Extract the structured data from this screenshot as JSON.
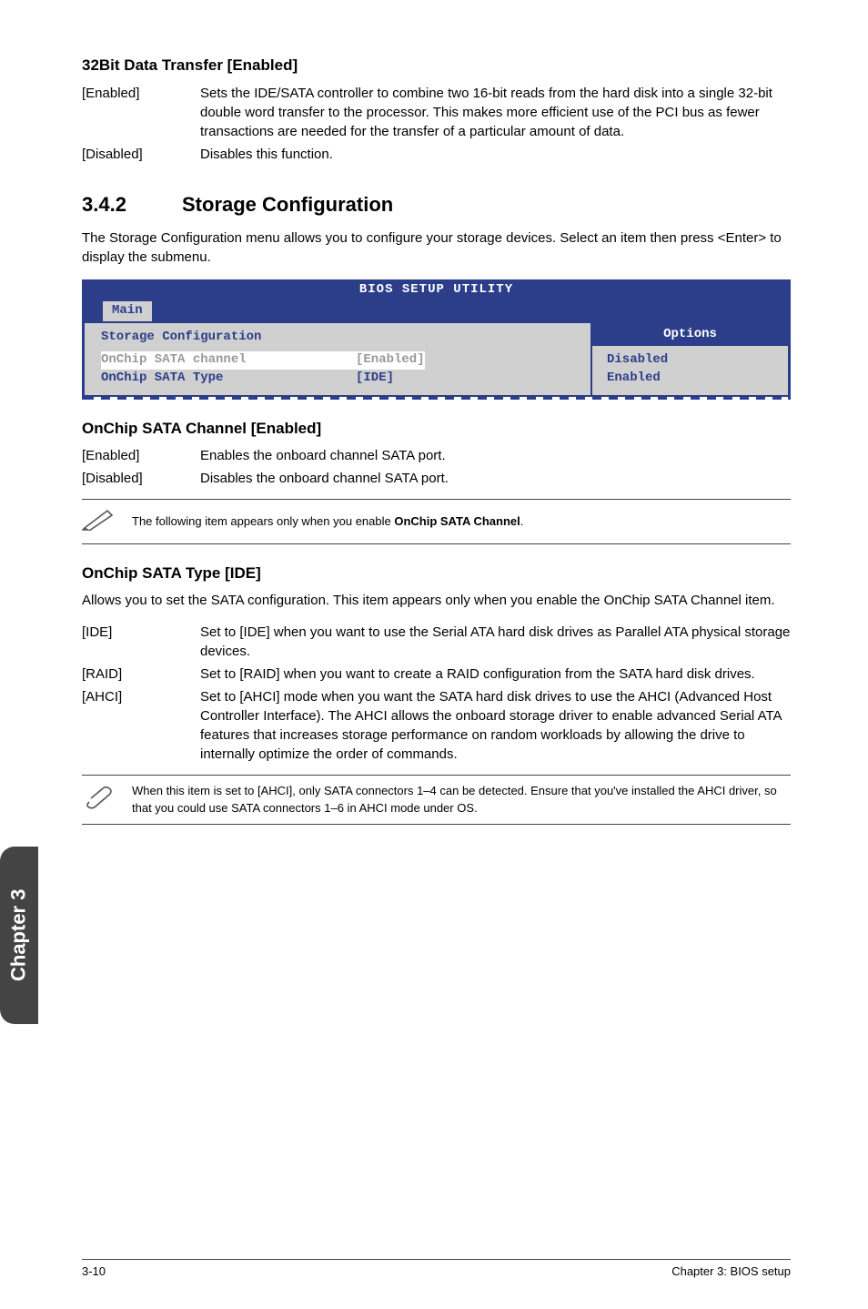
{
  "sections": {
    "s1": {
      "title": "32Bit Data Transfer [Enabled]",
      "defs": [
        {
          "term": "[Enabled]",
          "body": "Sets the IDE/SATA controller to combine two 16-bit reads from the hard disk into a single 32-bit double word transfer to the processor. This makes more efficient use of the PCI bus as fewer transactions are needed for the transfer of a particular amount of data."
        },
        {
          "term": "[Disabled]",
          "body": "Disables this function."
        }
      ]
    },
    "s2": {
      "num": "3.4.2",
      "title": "Storage Configuration",
      "para": "The Storage Configuration menu allows you to configure your storage devices. Select an item then press <Enter> to display the submenu."
    },
    "bios": {
      "title": "BIOS SETUP UTILITY",
      "tab": "Main",
      "left_heading": "Storage Configuration",
      "rows": [
        {
          "label": "OnChip SATA channel",
          "value": "[Enabled]"
        },
        {
          "label": "OnChip SATA Type",
          "value": "[IDE]"
        }
      ],
      "right_heading": "Options",
      "options": [
        "Disabled",
        "Enabled"
      ]
    },
    "s3": {
      "title": "OnChip SATA Channel [Enabled]",
      "defs": [
        {
          "term": "[Enabled]",
          "body": "Enables the onboard channel SATA port."
        },
        {
          "term": "[Disabled]",
          "body": "Disables the onboard channel SATA port."
        }
      ]
    },
    "note1": {
      "pre": "The following item appears only when you enable ",
      "bold": "OnChip SATA Channel",
      "post": "."
    },
    "s4": {
      "title": "OnChip SATA Type [IDE]",
      "para": "Allows you to set the SATA configuration. This item appears only when you enable the OnChip SATA Channel item.",
      "defs": [
        {
          "term": "[IDE]",
          "body": "Set to [IDE] when you want to use the Serial ATA hard disk drives as Parallel ATA physical storage devices."
        },
        {
          "term": "[RAID]",
          "body": "Set to [RAID] when you want to create a RAID configuration from the SATA hard disk drives."
        },
        {
          "term": "[AHCI]",
          "body": "Set to [AHCI] mode when you want the SATA hard disk drives to use the AHCI (Advanced Host Controller Interface). The AHCI allows the onboard storage driver to enable advanced Serial ATA features that increases storage performance on random workloads by allowing the drive to internally optimize the order of commands."
        }
      ]
    },
    "note2": {
      "text": "When this item is set to [AHCI], only SATA connectors 1–4 can be detected. Ensure that you've installed the AHCI driver, so that you could use SATA connectors 1–6 in AHCI mode under OS."
    }
  },
  "sidetab": "Chapter 3",
  "footer": {
    "left": "3-10",
    "right": "Chapter 3: BIOS setup"
  }
}
